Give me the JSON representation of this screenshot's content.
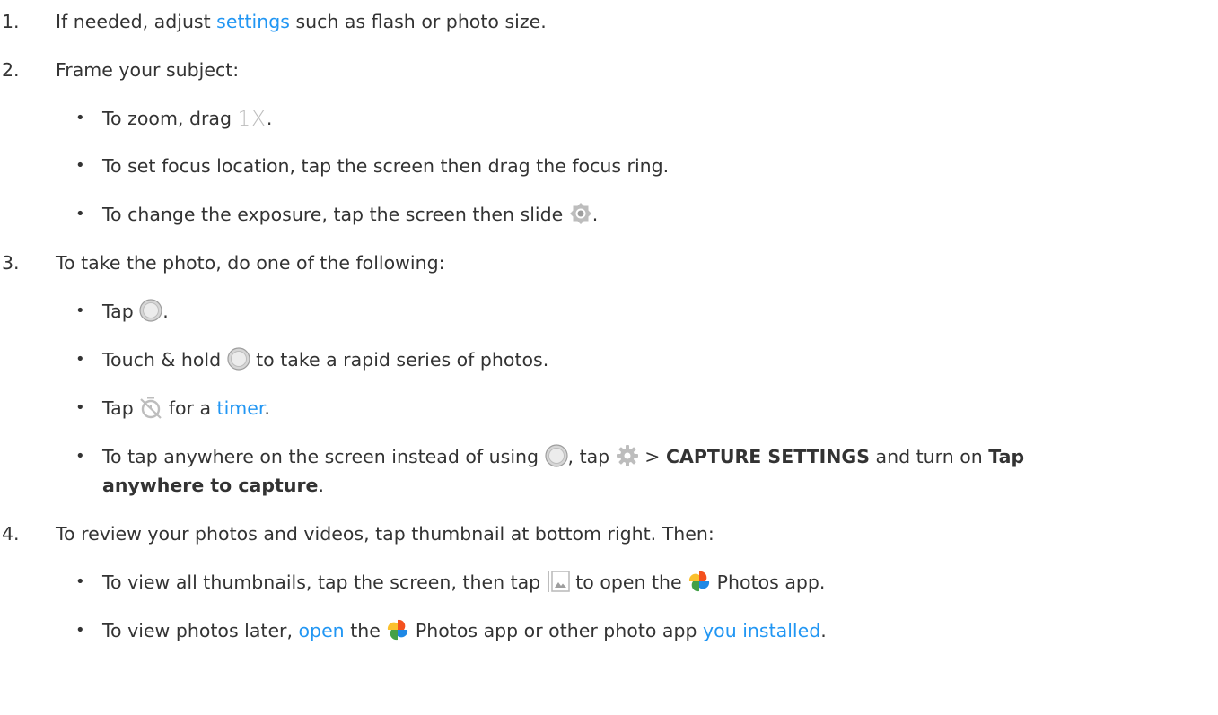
{
  "steps": [
    {
      "number": "1.",
      "before": "If needed, adjust ",
      "link": "settings",
      "after": " such as flash or photo size."
    },
    {
      "number": "2.",
      "text": "Frame your subject:",
      "bullets": [
        {
          "before": "To zoom, drag ",
          "icon_text": "1X",
          "after": "."
        },
        {
          "text": "To set focus location, tap the screen then drag the focus ring."
        },
        {
          "before": "To change the exposure, tap the screen then slide ",
          "after": "."
        }
      ]
    },
    {
      "number": "3.",
      "text": "To take the photo, do one of the following:",
      "bullets": [
        {
          "before": "Tap ",
          "after": "."
        },
        {
          "before": "Touch & hold ",
          "after": " to take a rapid series of photos."
        },
        {
          "before": "Tap ",
          "mid": " for a ",
          "link": "timer",
          "after": "."
        },
        {
          "before": "To tap anywhere on the screen instead of using ",
          "mid1": ", tap ",
          "mid2": " > ",
          "bold1": "CAPTURE SETTINGS",
          "mid3": " and turn on ",
          "bold2a": "Tap",
          "bold2b": "anywhere to capture",
          "after": "."
        }
      ]
    },
    {
      "number": "4.",
      "text": "To review your photos and videos, tap thumbnail at bottom right. Then:",
      "bullets": [
        {
          "before": "To view all thumbnails, tap the screen, then tap ",
          "mid": " to open the ",
          "after": " Photos app."
        },
        {
          "before": "To view photos later, ",
          "link1": "open",
          "mid": " the ",
          "mid2": " Photos app or other photo app ",
          "link2": "you installed",
          "after": "."
        }
      ]
    }
  ],
  "icons": {
    "exposure": "exposure-sun-icon",
    "shutter": "shutter-button-icon",
    "timer": "timer-off-icon",
    "settings": "gear-icon",
    "gallery": "gallery-thumbnail-icon",
    "photos": "google-photos-pinwheel-icon"
  },
  "colors": {
    "text": "#333333",
    "link": "#2196f3",
    "icon_gray": "#b3b3b3"
  }
}
